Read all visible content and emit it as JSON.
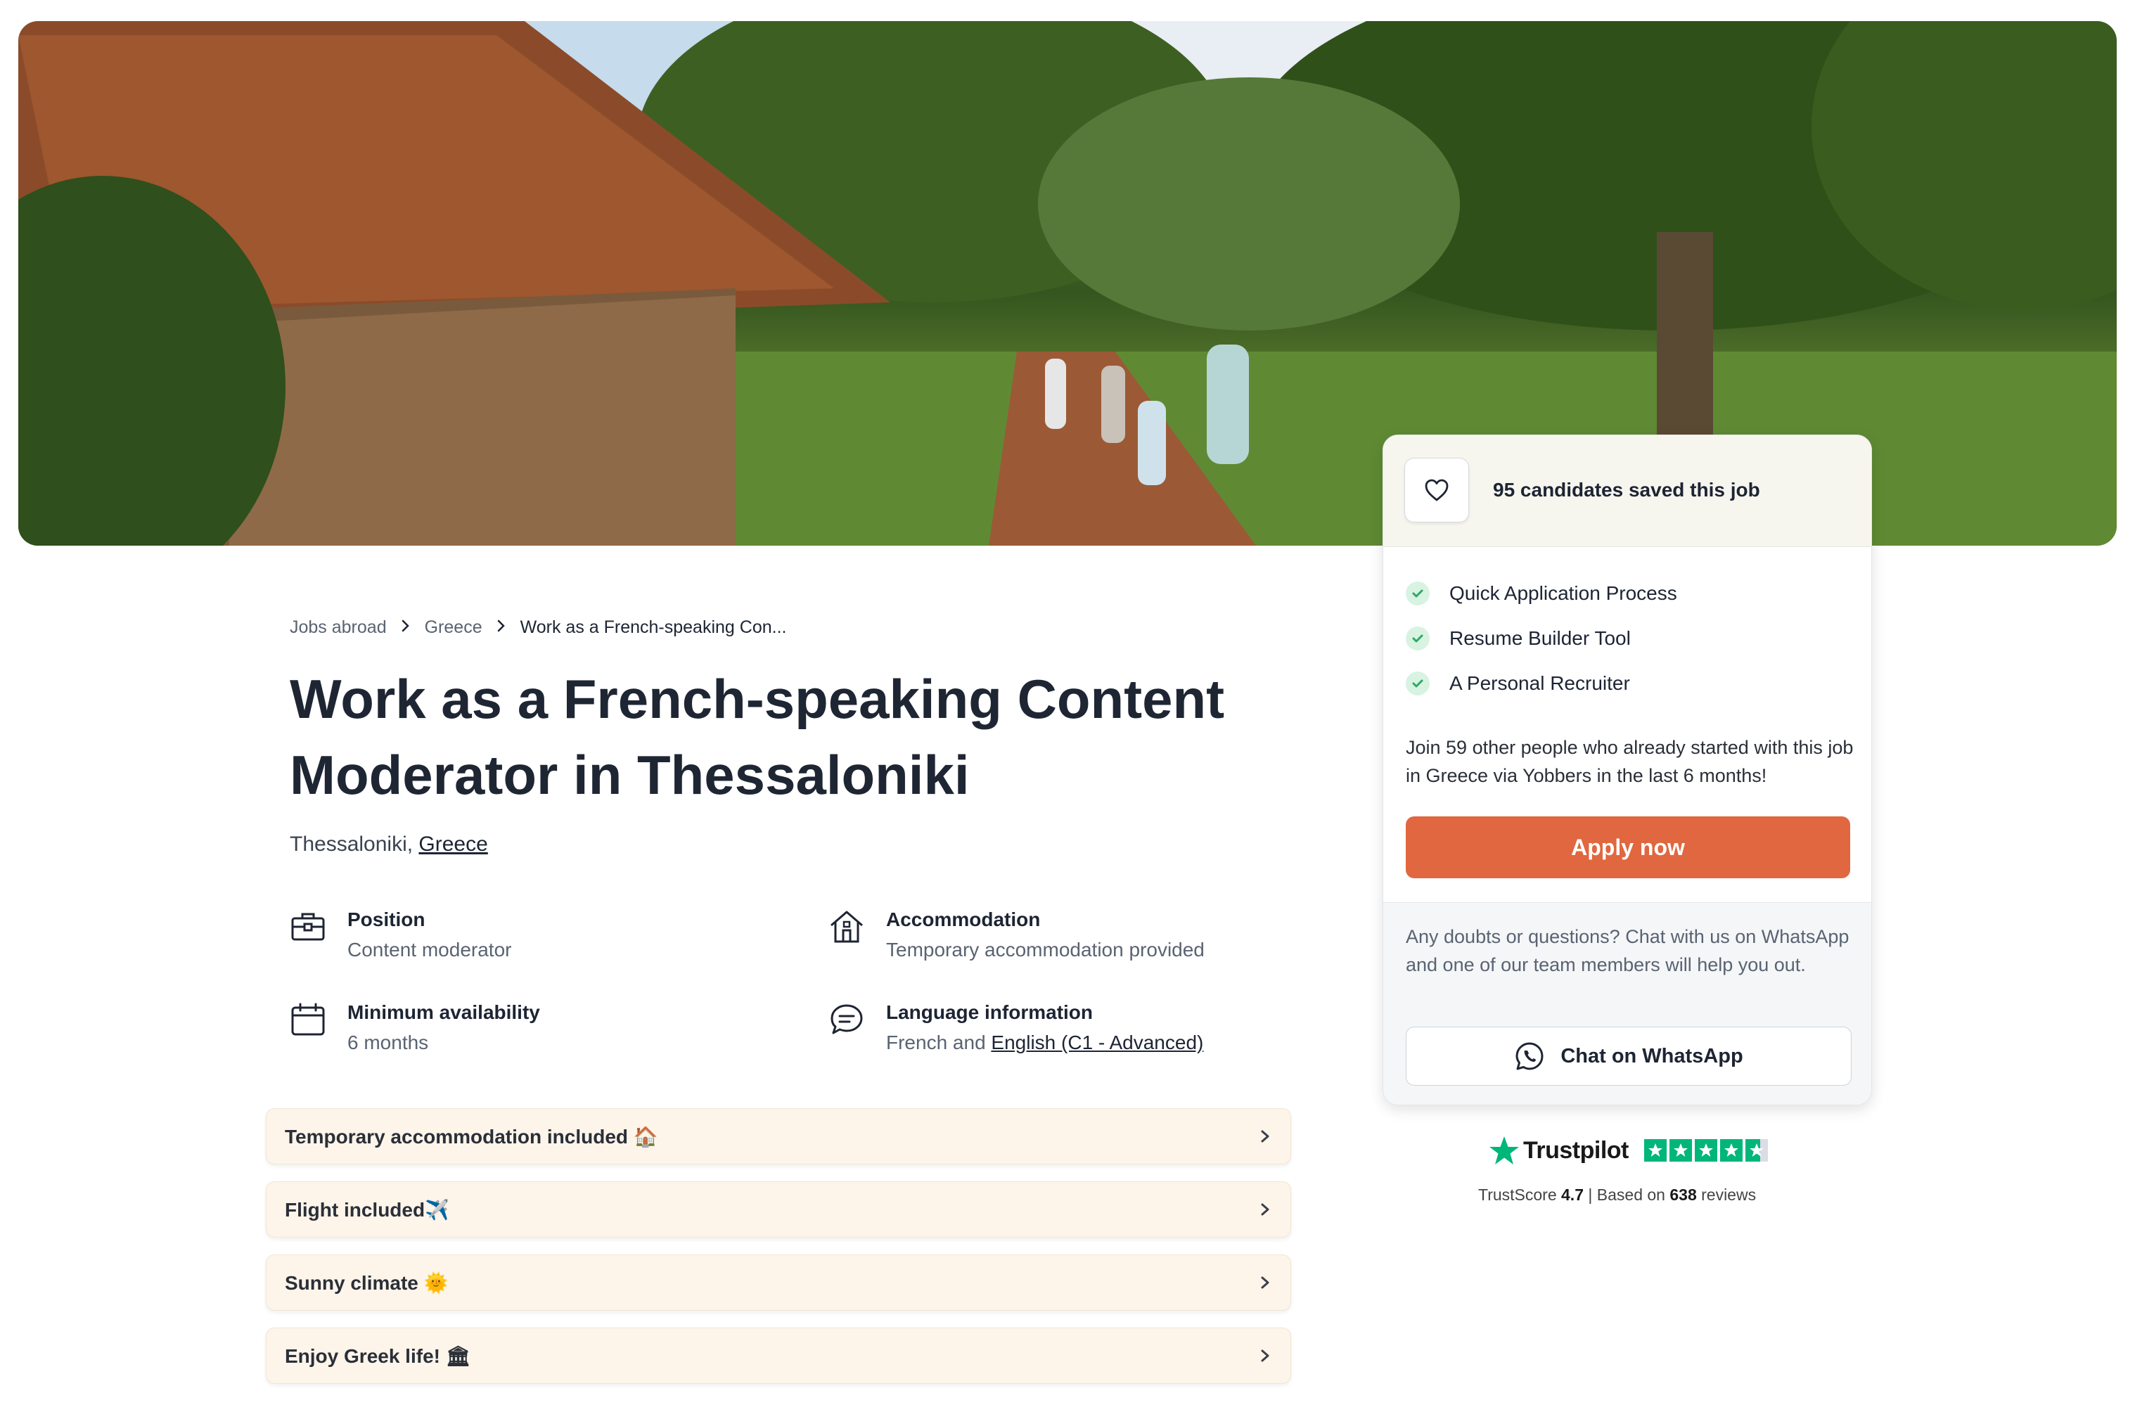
{
  "hero": {
    "alt": "Village path with people walking among trees"
  },
  "breadcrumb": {
    "items": [
      "Jobs abroad",
      "Greece",
      "Work as a French-speaking Con..."
    ]
  },
  "job": {
    "title": "Work as a French-speaking Content Moderator in Thessaloniki",
    "city": "Thessaloniki,",
    "country_link": "Greece"
  },
  "info": {
    "position": {
      "label": "Position",
      "value": "Content moderator",
      "icon": "briefcase-icon"
    },
    "accommodation": {
      "label": "Accommodation",
      "value": "Temporary accommodation provided",
      "icon": "house-icon"
    },
    "availability": {
      "label": "Minimum availability",
      "value": "6 months",
      "icon": "calendar-icon"
    },
    "language": {
      "label": "Language information",
      "value_prefix": "French and ",
      "value_link": "English (C1 - Advanced)",
      "icon": "speech-bubble-icon"
    }
  },
  "perks": [
    {
      "label": "Temporary accommodation included 🏠"
    },
    {
      "label": "Flight included✈️"
    },
    {
      "label": "Sunny climate 🌞"
    },
    {
      "label": "Enjoy Greek life! 🏛"
    }
  ],
  "card": {
    "saved_text": "95 candidates saved this job",
    "features": [
      "Quick Application Process",
      "Resume Builder Tool",
      "A Personal Recruiter"
    ],
    "join_text": "Join 59 other people who already started with this job in Greece via Yobbers in the last 6 months!",
    "apply_label": "Apply now",
    "doubts_text": "Any doubts or questions? Chat with us on WhatsApp and one of our team members will help you out.",
    "whatsapp_label": "Chat on WhatsApp"
  },
  "trustpilot": {
    "brand": "Trustpilot",
    "score_label": "TrustScore",
    "score": "4.7",
    "separator": "|",
    "based_on": "Based on",
    "reviews_count": "638",
    "reviews_word": "reviews",
    "rating": 4.7
  },
  "colors": {
    "accent": "#e0673f",
    "check_bg": "#d8f3e1",
    "check": "#2fa86a",
    "perk_bg": "#fdf4ea",
    "trustpilot_green": "#00b67a"
  }
}
